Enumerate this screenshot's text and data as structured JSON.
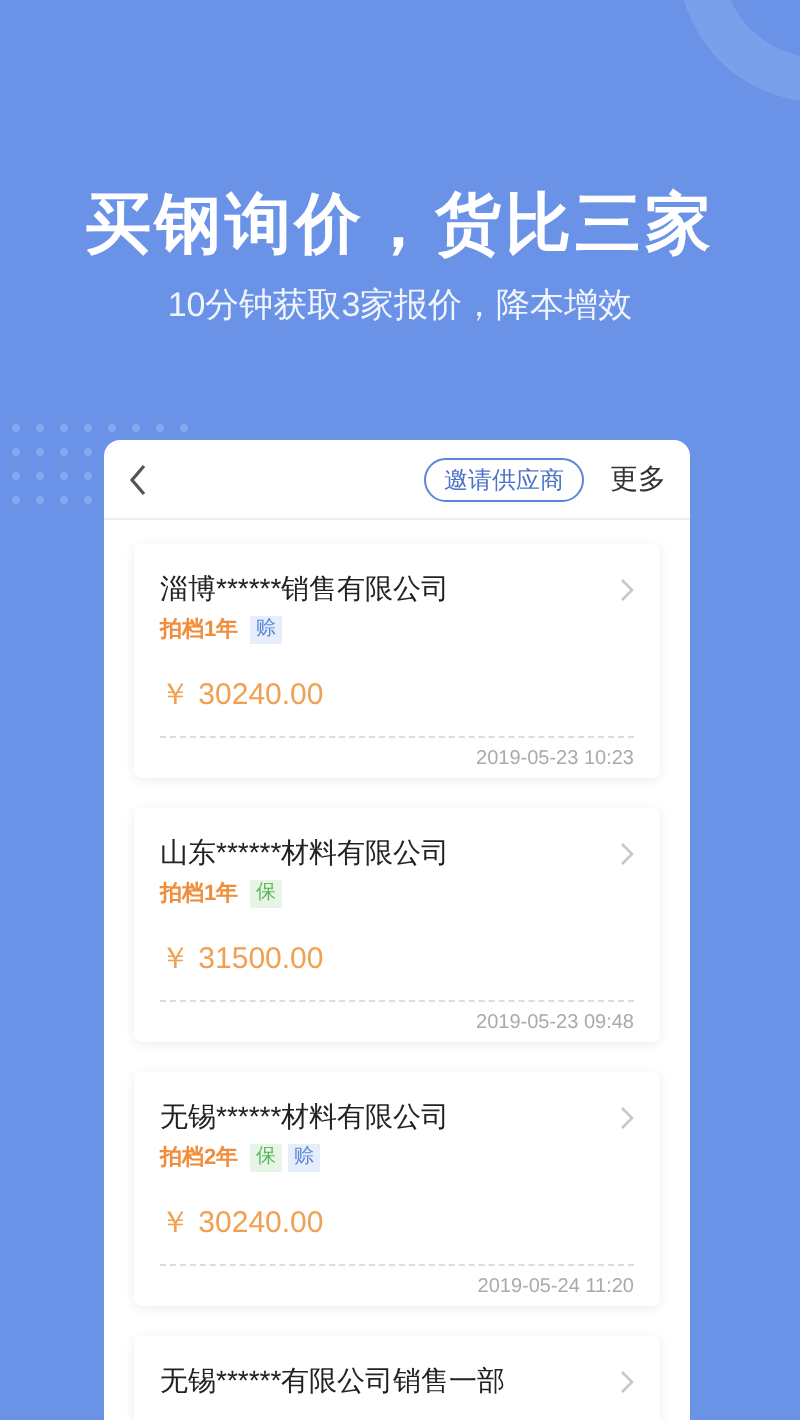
{
  "headline": "买钢询价，货比三家",
  "subheadline": "10分钟获取3家报价，降本增效",
  "panel": {
    "invite_button": "邀请供应商",
    "more_link": "更多"
  },
  "quotes": [
    {
      "company": "淄博******销售有限公司",
      "partner": "拍档1年",
      "badges": [
        {
          "kind": "credit",
          "label": "赊"
        }
      ],
      "price": "￥ 30240.00",
      "time": "2019-05-23 10:23"
    },
    {
      "company": "山东******材料有限公司",
      "partner": "拍档1年",
      "badges": [
        {
          "kind": "guarantee",
          "label": "保"
        }
      ],
      "price": "￥ 31500.00",
      "time": "2019-05-23 09:48"
    },
    {
      "company": "无锡******材料有限公司",
      "partner": "拍档2年",
      "badges": [
        {
          "kind": "guarantee",
          "label": "保"
        },
        {
          "kind": "credit",
          "label": "赊"
        }
      ],
      "price": "￥ 30240.00",
      "time": "2019-05-24 11:20"
    },
    {
      "company": "无锡******有限公司销售一部"
    }
  ]
}
